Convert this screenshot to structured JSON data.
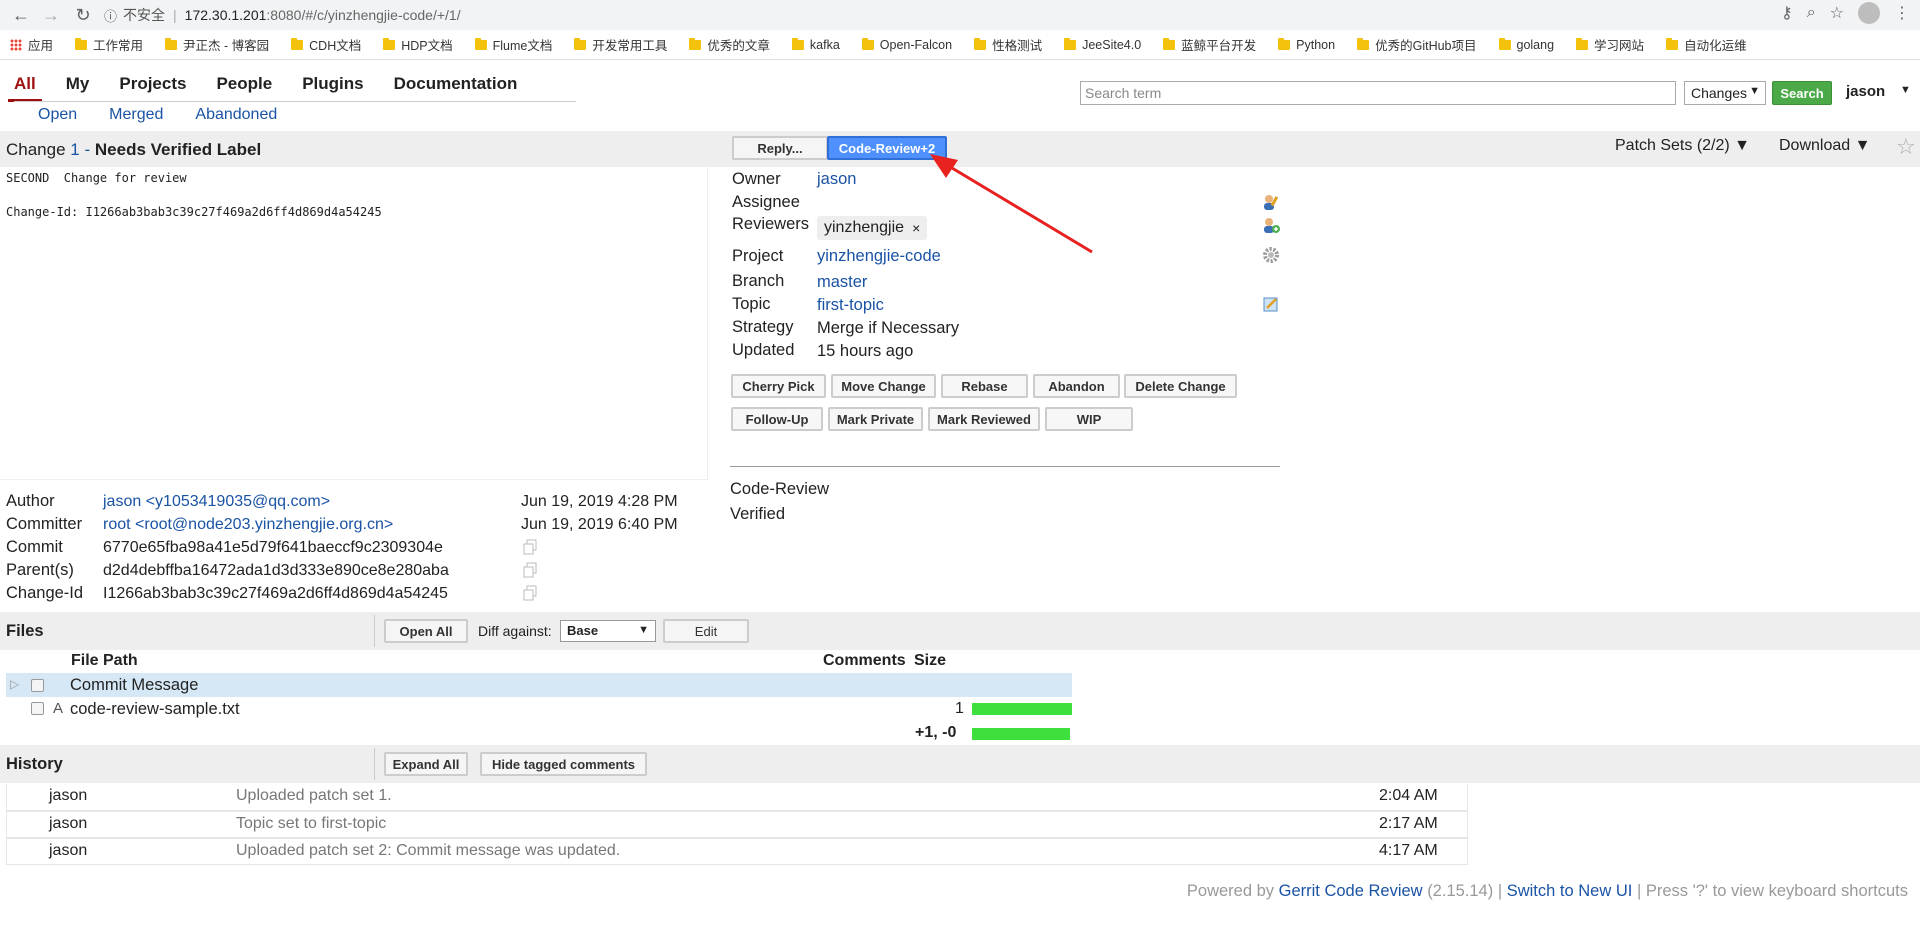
{
  "browser": {
    "security_label": "不安全",
    "url_host": "172.30.1.201",
    "url_rest": ":8080/#/c/yinzhengjie-code/+/1/",
    "bookmarks": [
      "应用",
      "工作常用",
      "尹正杰 - 博客园",
      "CDH文档",
      "HDP文档",
      "Flume文档",
      "开发常用工具",
      "优秀的文章",
      "kafka",
      "Open-Falcon",
      "性格测试",
      "JeeSite4.0",
      "蓝鲸平台开发",
      "Python",
      "优秀的GitHub项目",
      "golang",
      "学习网站",
      "自动化运维"
    ]
  },
  "nav": {
    "tabs": [
      "All",
      "My",
      "Projects",
      "People",
      "Plugins",
      "Documentation"
    ],
    "sub": [
      "Open",
      "Merged",
      "Abandoned"
    ],
    "search_placeholder": "Search term",
    "search_select": "Changes",
    "search_button": "Search",
    "user": "jason"
  },
  "change": {
    "prefix": "Change",
    "number": "1",
    "sep": "-",
    "status": "Needs Verified Label",
    "reply_button": "Reply...",
    "quick_approve": "Code-Review+2",
    "patch_sets": "Patch Sets (2/2)",
    "download": "Download",
    "commit_message": "SECOND  Change for review\n\nChange-Id: I1266ab3bab3c39c27f469a2d6ff4d869d4a54245"
  },
  "info": {
    "owner_label": "Owner",
    "owner": "jason",
    "assignee_label": "Assignee",
    "reviewers_label": "Reviewers",
    "reviewer": "yinzhengjie",
    "reviewer_remove": "×",
    "project_label": "Project",
    "project": "yinzhengjie-code",
    "branch_label": "Branch",
    "branch": "master",
    "topic_label": "Topic",
    "topic": "first-topic",
    "strategy_label": "Strategy",
    "strategy": "Merge if Necessary",
    "updated_label": "Updated",
    "updated": "15 hours ago",
    "actions_row1": [
      "Cherry Pick",
      "Move Change",
      "Rebase",
      "Abandon",
      "Delete Change"
    ],
    "actions_row2": [
      "Follow-Up",
      "Mark Private",
      "Mark Reviewed",
      "WIP"
    ],
    "label_code_review": "Code-Review",
    "label_verified": "Verified"
  },
  "meta": {
    "author_label": "Author",
    "author": "jason <y1053419035@qq.com>",
    "author_date": "Jun 19, 2019 4:28 PM",
    "committer_label": "Committer",
    "committer": "root <root@node203.yinzhengjie.org.cn>",
    "committer_date": "Jun 19, 2019 6:40 PM",
    "commit_label": "Commit",
    "commit": "6770e65fba98a41e5d79f641baeccf9c2309304e",
    "parent_label": "Parent(s)",
    "parent": "d2d4debffba16472ada1d3d333e890ce8e280aba",
    "changeid_label": "Change-Id",
    "changeid": "I1266ab3bab3c39c27f469a2d6ff4d869d4a54245"
  },
  "files": {
    "title": "Files",
    "open_all": "Open All",
    "diff_label": "Diff against:",
    "diff_value": "Base",
    "edit": "Edit",
    "col_path": "File Path",
    "col_comments": "Comments",
    "col_size": "Size",
    "rows": [
      {
        "status": "",
        "path": "Commit Message",
        "size": ""
      },
      {
        "status": "A",
        "path": "code-review-sample.txt",
        "size": "1"
      }
    ],
    "total": "+1, -0"
  },
  "history": {
    "title": "History",
    "expand_all": "Expand All",
    "hide_tagged": "Hide tagged comments",
    "rows": [
      {
        "author": "jason",
        "message": "Uploaded patch set 1.",
        "time": "2:04 AM"
      },
      {
        "author": "jason",
        "message": "Topic set to first-topic",
        "time": "2:17 AM"
      },
      {
        "author": "jason",
        "message": "Uploaded patch set 2: Commit message was updated.",
        "time": "4:17 AM"
      }
    ]
  },
  "footer": {
    "powered_by": "Powered by",
    "product": "Gerrit Code Review",
    "version": "(2.15.14)",
    "sep1": "|",
    "switch_ui": "Switch to New UI",
    "sep2": "|",
    "shortcuts": "Press '?' to view keyboard shortcuts"
  },
  "colors": {
    "active_tab": "#a01010",
    "link": "#1a53a5",
    "search_button": "#4ca948",
    "quick_approve": "#4d90fe",
    "size_bar": "#3ee03e",
    "highlight_row": "#d6e8f5",
    "annotation_arrow": "#e8231f"
  }
}
